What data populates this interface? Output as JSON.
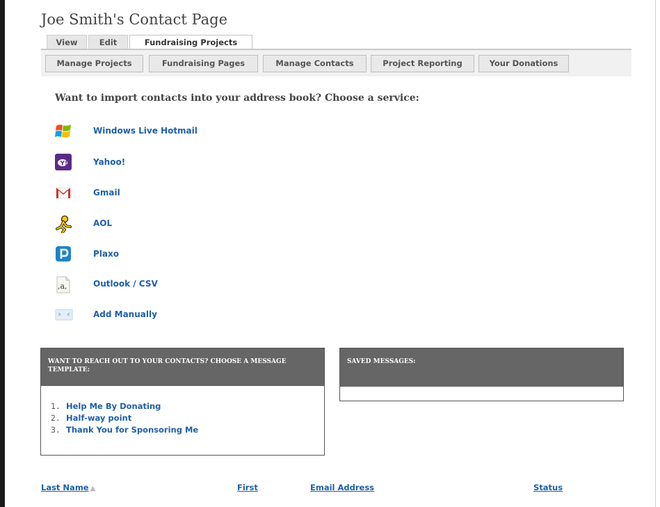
{
  "page": {
    "title": "Joe Smith's Contact Page"
  },
  "tabs": [
    {
      "label": "View",
      "active": false
    },
    {
      "label": "Edit",
      "active": false
    },
    {
      "label": "Fundraising Projects",
      "active": true
    }
  ],
  "subnav": [
    {
      "label": "Manage Projects"
    },
    {
      "label": "Fundraising Pages"
    },
    {
      "label": "Manage Contacts"
    },
    {
      "label": "Project Reporting"
    },
    {
      "label": "Your Donations"
    }
  ],
  "import": {
    "heading": "Want to import contacts into your address book? Choose a service:",
    "services": [
      {
        "label": "Windows Live Hotmail",
        "icon": "windows-icon"
      },
      {
        "label": "Yahoo!",
        "icon": "yahoo-icon"
      },
      {
        "label": "Gmail",
        "icon": "gmail-icon"
      },
      {
        "label": "AOL",
        "icon": "aol-icon"
      },
      {
        "label": "Plaxo",
        "icon": "plaxo-icon"
      },
      {
        "label": "Outlook / CSV",
        "icon": "outlook-csv-icon"
      },
      {
        "label": "Add Manually",
        "icon": "envelope-icon"
      }
    ]
  },
  "templates_panel": {
    "heading": "WANT TO REACH OUT TO YOUR CONTACTS? CHOOSE A MESSAGE TEMPLATE:",
    "items": [
      {
        "number": "1.",
        "label": "Help Me By Donating"
      },
      {
        "number": "2.",
        "label": "Half-way point"
      },
      {
        "number": "3.",
        "label": "Thank You for Sponsoring Me"
      }
    ]
  },
  "saved_panel": {
    "heading": "SAVED MESSAGES:"
  },
  "table": {
    "columns": [
      {
        "label": "Last Name",
        "sorted": "ascending"
      },
      {
        "label": "First"
      },
      {
        "label": "Email Address"
      },
      {
        "label": "Status"
      }
    ]
  },
  "colors": {
    "link": "#1f5fa8",
    "panel_header": "#666666",
    "left_bar": "#1a1a1a"
  }
}
